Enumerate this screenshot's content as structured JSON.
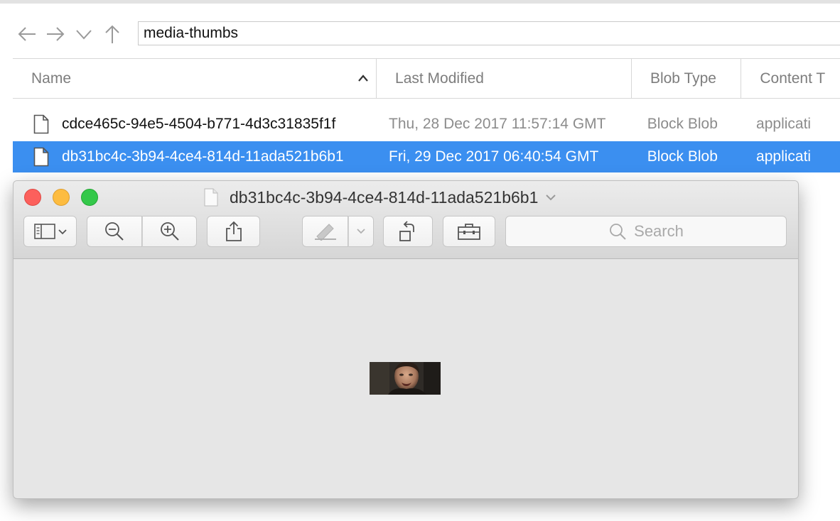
{
  "navigation": {
    "back_icon": "arrow-left",
    "forward_icon": "arrow-right",
    "recent_icon": "chevron-down",
    "up_icon": "arrow-up",
    "path": "media-thumbs"
  },
  "table": {
    "columns": [
      "Name",
      "Last Modified",
      "Blob Type",
      "Content T"
    ],
    "sort_column": "Name",
    "rows": [
      {
        "name": "cdce465c-94e5-4504-b771-4d3c31835f1f",
        "last_modified": "Thu, 28 Dec 2017 11:57:14 GMT",
        "blob_type": "Block Blob",
        "content_type": "applicati",
        "selected": false
      },
      {
        "name": "db31bc4c-3b94-4ce4-814d-11ada521b6b1",
        "last_modified": "Fri, 29 Dec 2017 06:40:54 GMT",
        "blob_type": "Block Blob",
        "content_type": "applicati",
        "selected": true
      }
    ]
  },
  "preview_window": {
    "title": "db31bc4c-3b94-4ce4-814d-11ada521b6b1",
    "search_placeholder": "Search",
    "toolbar_icons": [
      "sidebar-icon",
      "zoom-out-icon",
      "zoom-in-icon",
      "share-icon",
      "markup-pen-icon",
      "rotate-icon",
      "toolbox-icon",
      "search-icon"
    ],
    "content": "thumbnail-image"
  },
  "colors": {
    "selection": "#3b8ff0",
    "close": "#fc605c",
    "minimize": "#fdbc40",
    "maximize": "#34c84a"
  }
}
